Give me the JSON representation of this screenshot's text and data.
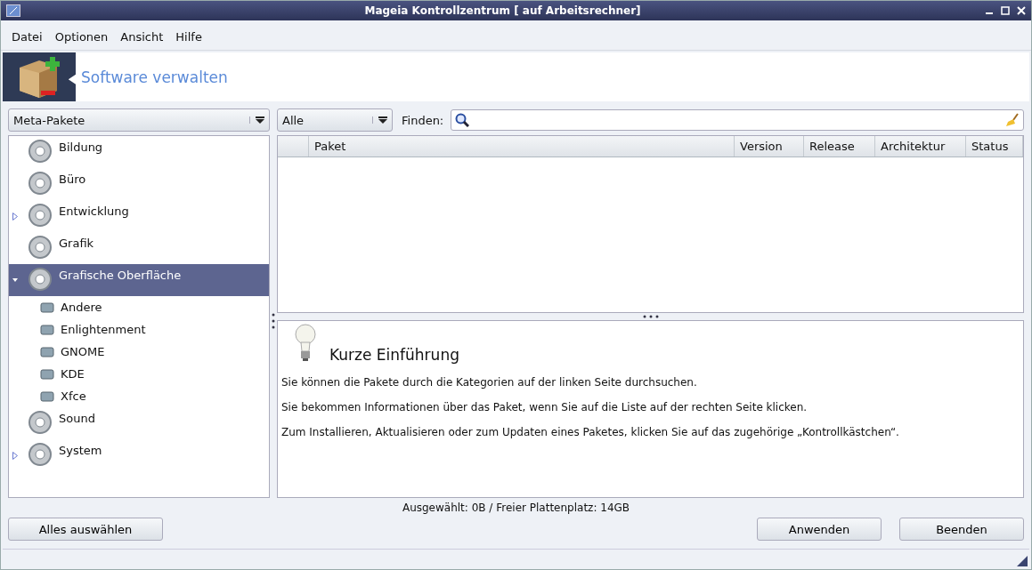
{
  "window": {
    "title": "Mageia Kontrollzentrum  [ auf Arbeitsrechner]"
  },
  "menu": [
    "Datei",
    "Optionen",
    "Ansicht",
    "Hilfe"
  ],
  "banner": {
    "title": "Software verwalten"
  },
  "filter_combo": {
    "value": "Meta-Pakete"
  },
  "type_combo": {
    "value": "Alle"
  },
  "search": {
    "label": "Finden:"
  },
  "tree": [
    {
      "label": "Bildung",
      "selected": false
    },
    {
      "label": "Büro",
      "selected": false
    },
    {
      "label": "Entwicklung",
      "selected": false,
      "expanded": false
    },
    {
      "label": "Grafik",
      "selected": false
    },
    {
      "label": "Grafische Oberfläche",
      "selected": true,
      "expanded": true,
      "children": [
        {
          "label": "Andere",
          "selected": false
        },
        {
          "label": "Enlightenment",
          "selected": false
        },
        {
          "label": "GNOME",
          "selected": false
        },
        {
          "label": "KDE",
          "selected": false
        },
        {
          "label": "Xfce",
          "selected": false
        }
      ]
    },
    {
      "label": "Sound",
      "selected": false
    },
    {
      "label": "System",
      "selected": false,
      "expanded": false
    }
  ],
  "table": {
    "columns": [
      "Paket",
      "Version",
      "Release",
      "Architektur",
      "Status"
    ]
  },
  "intro": {
    "title": "Kurze Einführung",
    "paragraphs": [
      "Sie können die Pakete durch die Kategorien auf der linken Seite durchsuchen.",
      "Sie bekommen Informationen über das Paket, wenn Sie auf die Liste auf der rechten Seite klicken.",
      "Zum Installieren, Aktualisieren oder zum Updaten eines Paketes, klicken Sie auf das zugehörige „Kontrollkästchen“."
    ]
  },
  "status": "Ausgewählt: 0B / Freier Plattenplatz: 14GB",
  "buttons": {
    "left": "Alles auswählen",
    "right": [
      "Anwenden",
      "Beenden"
    ]
  }
}
